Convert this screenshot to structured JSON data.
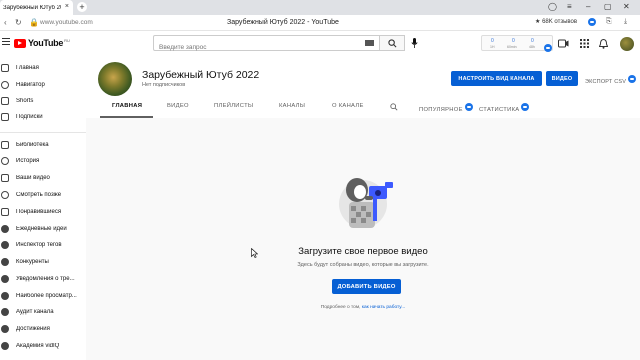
{
  "browser": {
    "tab_title": "Зарубежный Ютуб 202",
    "tab_close": "×",
    "new_tab": "+",
    "url": "www.youtube.com",
    "page_title": "Зарубежный Ютуб 2022 - YouTube",
    "reviews": "68K отзывов"
  },
  "header": {
    "logo_text": "YouTube",
    "logo_region": "RU",
    "search_placeholder": "Введите запрос",
    "stats": [
      {
        "value": "0",
        "label": "1H"
      },
      {
        "value": "0",
        "label": "60min"
      },
      {
        "value": "0",
        "label": "48h"
      }
    ]
  },
  "sidebar": {
    "items": [
      {
        "label": "Главная",
        "icon": "home-icon"
      },
      {
        "label": "Навигатор",
        "icon": "compass-icon"
      },
      {
        "label": "Shorts",
        "icon": "shorts-icon"
      },
      {
        "label": "Подписки",
        "icon": "subscriptions-icon"
      },
      {
        "label": "Библиотека",
        "icon": "library-icon"
      },
      {
        "label": "История",
        "icon": "history-icon"
      },
      {
        "label": "Ваши видео",
        "icon": "your-videos-icon"
      },
      {
        "label": "Смотреть позже",
        "icon": "watch-later-icon"
      },
      {
        "label": "Понравившиеся",
        "icon": "like-icon"
      },
      {
        "label": "Ежедневные идеи",
        "icon": "vidiq-icon"
      },
      {
        "label": "Инспектор тегов",
        "icon": "vidiq-icon"
      },
      {
        "label": "Конкуренты",
        "icon": "vidiq-icon"
      },
      {
        "label": "Уведомления о тре...",
        "icon": "vidiq-icon"
      },
      {
        "label": "Наиболее просматр...",
        "icon": "vidiq-icon"
      },
      {
        "label": "Аудит канала",
        "icon": "vidiq-icon"
      },
      {
        "label": "Достижения",
        "icon": "vidiq-icon"
      },
      {
        "label": "Академия vidIQ",
        "icon": "vidiq-icon"
      }
    ]
  },
  "channel": {
    "name": "Зарубежный Ютуб 2022",
    "subscribers": "Нет подписчиков",
    "customize_button": "НАСТРОИТЬ ВИД КАНАЛА",
    "video_button": "ВИДЕО",
    "export_csv": "ЭКСПОРТ CSV",
    "tabs": [
      {
        "label": "ГЛАВНАЯ",
        "active": true
      },
      {
        "label": "ВИДЕО",
        "active": false
      },
      {
        "label": "ПЛЕЙЛИСТЫ",
        "active": false
      },
      {
        "label": "КАНАЛЫ",
        "active": false
      },
      {
        "label": "О КАНАЛЕ",
        "active": false
      },
      {
        "label": "ПОПУЛЯРНОЕ",
        "active": false
      },
      {
        "label": "СТАТИСТИКА",
        "active": false
      }
    ]
  },
  "empty_state": {
    "title": "Загрузите свое первое видео",
    "subtitle": "Здесь будут собраны видео, которые вы загрузите.",
    "button": "ДОБАВИТЬ ВИДЕО",
    "more_prefix": "Подробнее о том, ",
    "more_link": "как начать работу..."
  },
  "colors": {
    "accent": "#065fd4",
    "logo_red": "#ff0000",
    "main_bg": "#f9f9f9"
  }
}
